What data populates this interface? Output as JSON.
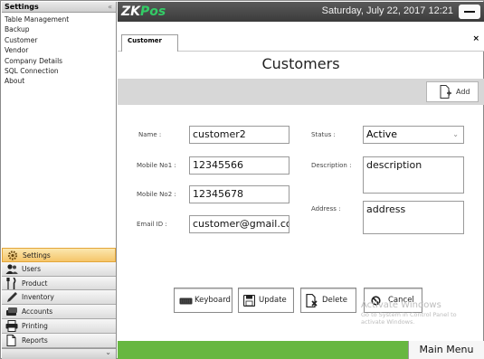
{
  "sidebar": {
    "title": "Settings",
    "collapse_glyph": "«",
    "items": [
      {
        "label": "Table Management"
      },
      {
        "label": "Backup"
      },
      {
        "label": "Customer"
      },
      {
        "label": "Vendor"
      },
      {
        "label": "Company Details"
      },
      {
        "label": "SQL Connection"
      },
      {
        "label": "About"
      }
    ],
    "nav": [
      {
        "label": "Settings",
        "icon": "gear-icon",
        "active": true
      },
      {
        "label": "Users",
        "icon": "users-icon",
        "active": false
      },
      {
        "label": "Product",
        "icon": "cutlery-icon",
        "active": false
      },
      {
        "label": "Inventory",
        "icon": "pencil-icon",
        "active": false
      },
      {
        "label": "Accounts",
        "icon": "money-icon",
        "active": false
      },
      {
        "label": "Printing",
        "icon": "printer-icon",
        "active": false
      },
      {
        "label": "Reports",
        "icon": "report-icon",
        "active": false
      }
    ],
    "bottom_arrow": "⌄"
  },
  "topbar": {
    "logo_zk": "ZK",
    "logo_pos": "Pos",
    "datetime": "Saturday, July 22, 2017 12:21"
  },
  "tabs": {
    "active_tab": "Customer",
    "close_glyph": "×"
  },
  "page": {
    "title": "Customers",
    "add_label": "Add"
  },
  "form": {
    "name_label": "Name :",
    "name_value": "customer2",
    "mobile1_label": "Mobile No1 :",
    "mobile1_value": "12345566",
    "mobile2_label": "Mobile No2 :",
    "mobile2_value": "12345678",
    "email_label": "Email ID :",
    "email_value": "customer@gmail.co",
    "status_label": "Status :",
    "status_value": "Active",
    "description_label": "Description :",
    "description_value": "description",
    "address_label": "Address :",
    "address_value": "address"
  },
  "actions": {
    "keyboard": "Keyboard",
    "update": "Update",
    "delete": "Delete",
    "cancel": "Cancel"
  },
  "watermark": {
    "title": "Activate Windows",
    "line1": "Go to System in Control Panel to",
    "line2": "activate Windows."
  },
  "bottombar": {
    "main_menu": "Main Menu"
  },
  "colors": {
    "topbar": "#4a4a4a",
    "logo_accent": "#33cc66",
    "bottombar": "#67b741",
    "active_nav": "#f5c56a"
  }
}
